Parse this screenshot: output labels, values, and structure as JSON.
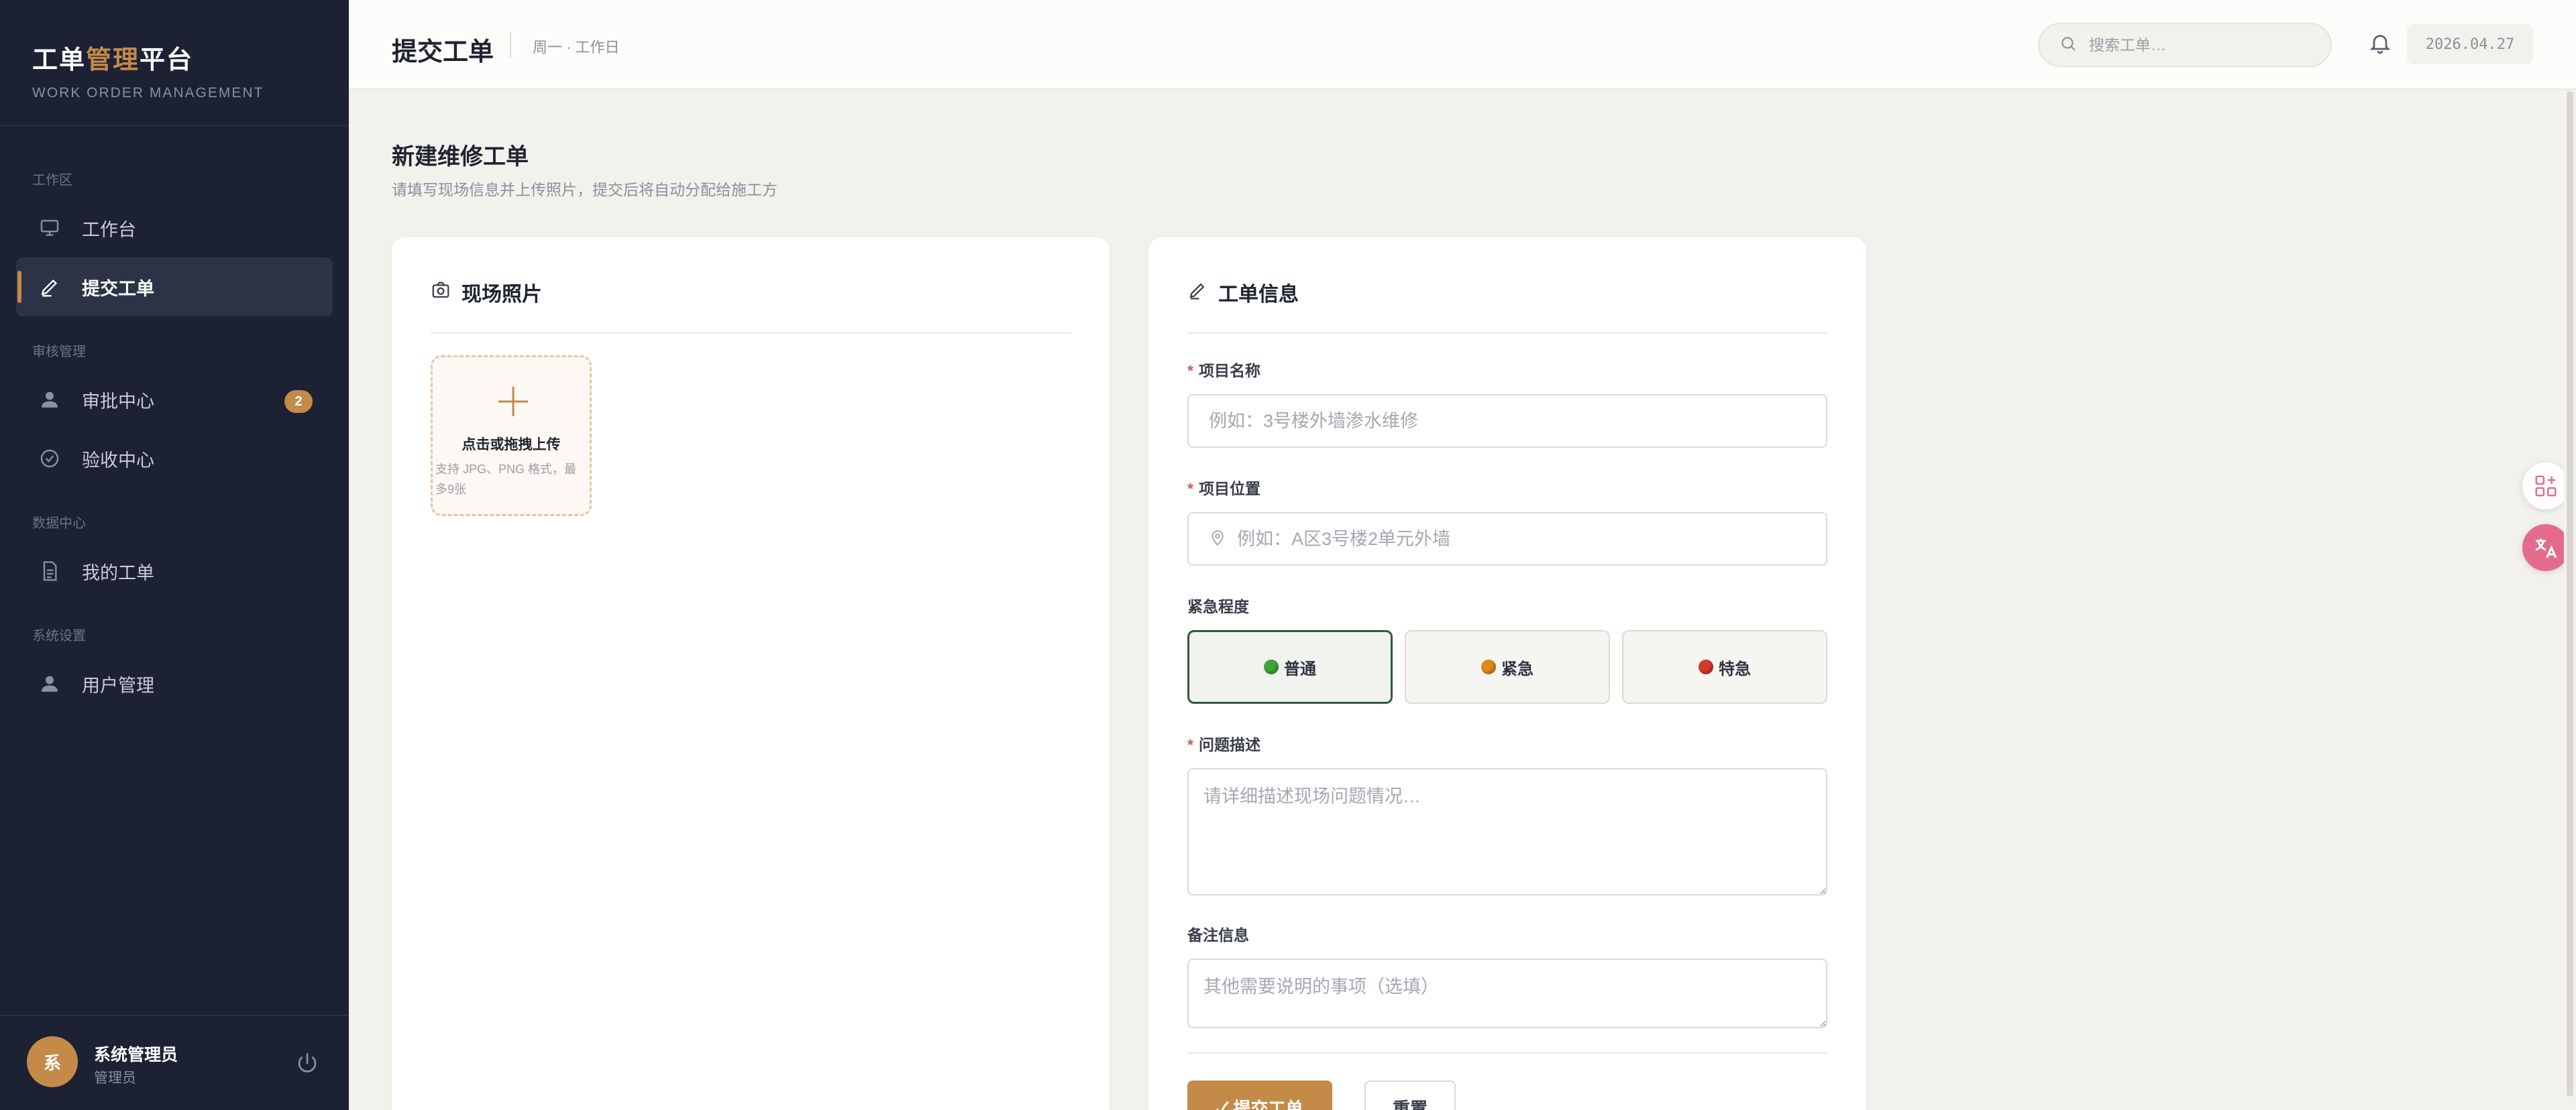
{
  "brand": {
    "title_a": "工单",
    "title_b": "管理",
    "title_c": "平台",
    "subtitle": "WORK ORDER MANAGEMENT"
  },
  "sidebar": {
    "sections": [
      "工作区",
      "审核管理",
      "数据中心",
      "系统设置"
    ],
    "items": [
      {
        "label": "工作台",
        "icon": "monitor-icon",
        "active": false
      },
      {
        "label": "提交工单",
        "icon": "pen-icon",
        "active": true
      },
      {
        "label": "审批中心",
        "icon": "user-icon",
        "active": false,
        "badge": "2"
      },
      {
        "label": "验收中心",
        "icon": "check-circle-icon",
        "active": false
      },
      {
        "label": "我的工单",
        "icon": "document-icon",
        "active": false
      },
      {
        "label": "用户管理",
        "icon": "user-icon",
        "active": false
      }
    ],
    "user": {
      "avatar": "系",
      "name": "系统管理员",
      "role": "管理员"
    }
  },
  "header": {
    "title": "提交工单",
    "subtitle": "周一 · 工作日",
    "search_placeholder": "搜索工单…",
    "date": "2026.04.27"
  },
  "page": {
    "title": "新建维修工单",
    "subtitle": "请填写现场信息并上传照片，提交后将自动分配给施工方"
  },
  "photos_card": {
    "title": "现场照片",
    "upload_label": "点击或拖拽上传",
    "upload_hint": "支持 JPG、PNG 格式，最多9张"
  },
  "info_card": {
    "title": "工单信息",
    "project_name": {
      "label": "项目名称",
      "placeholder": "例如：3号楼外墙渗水维修"
    },
    "project_location": {
      "label": "项目位置",
      "placeholder": "例如：A区3号楼2单元外墙"
    },
    "urgency": {
      "label": "紧急程度",
      "options": [
        {
          "label": "普通",
          "color": "#3fa53a",
          "selected": true
        },
        {
          "label": "紧急",
          "color": "#e08a1e",
          "selected": false
        },
        {
          "label": "特急",
          "color": "#d23a2e",
          "selected": false
        }
      ]
    },
    "description": {
      "label": "问题描述",
      "placeholder": "请详细描述现场问题情况…"
    },
    "remarks": {
      "label": "备注信息",
      "placeholder": "其他需要说明的事项（选填）"
    },
    "submit_label": "✓ 提交工单",
    "reset_label": "重置"
  },
  "colors": {
    "accent": "#c48a48",
    "sidebar_bg": "#1c2133",
    "page_bg": "#f3f1ec"
  }
}
